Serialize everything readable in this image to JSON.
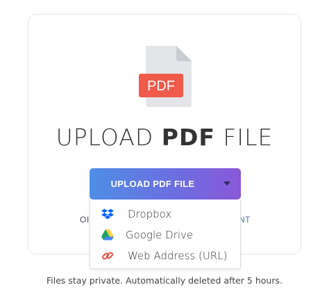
{
  "title": {
    "part1": "UPLOAD",
    "part2": "PDF",
    "part3": "FILE"
  },
  "file_icon": {
    "icon": "pdf-file-icon",
    "badge_text": "PDF",
    "badge_color": "#ef5a4a",
    "page_color": "#e3e5e8"
  },
  "upload_button": {
    "label": "UPLOAD PDF FILE",
    "toggle_icon": "caret-down-icon",
    "gradient_start": "#4f8ee6",
    "gradient_end": "#8a58d9"
  },
  "obscured_text": {
    "left": "OI",
    "right": "NT"
  },
  "dropdown": {
    "items": [
      {
        "label": "Dropbox",
        "icon": "dropbox-icon",
        "color": "#0061fe"
      },
      {
        "label": "Google Drive",
        "icon": "google-drive-icon",
        "color": "#1fa463"
      },
      {
        "label": "Web Address (URL)",
        "icon": "link-icon",
        "color": "#e74c3c"
      }
    ]
  },
  "footer": {
    "note": "Files stay private. Automatically deleted after 5 hours."
  }
}
